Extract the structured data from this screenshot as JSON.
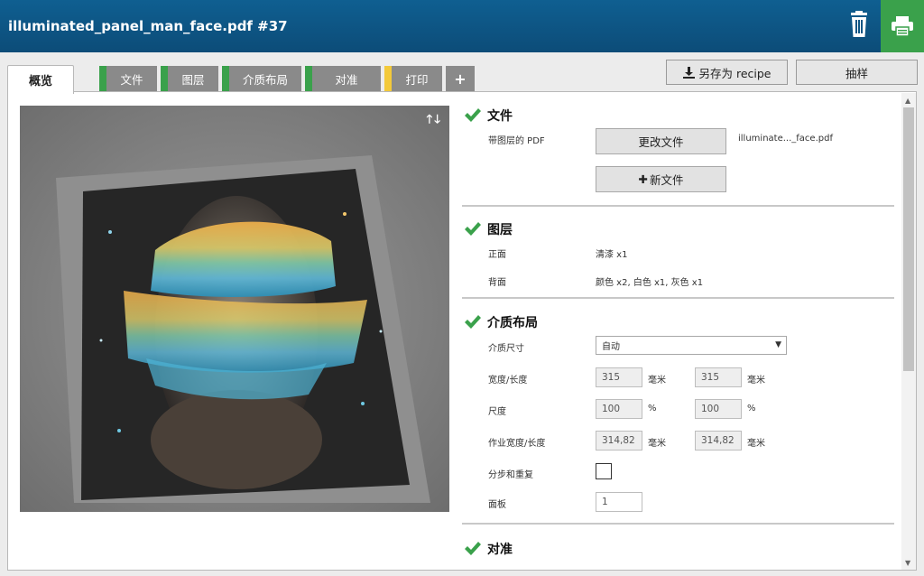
{
  "header": {
    "title": "illuminated_panel_man_face.pdf #37",
    "accent": "#0c4c78",
    "print_color": "#3aa14b"
  },
  "tabs": [
    {
      "label": "概览",
      "active": true
    },
    {
      "label": "文件",
      "status_color": "#3aa14b"
    },
    {
      "label": "图层",
      "status_color": "#3aa14b"
    },
    {
      "label": "介质布局",
      "status_color": "#3aa14b"
    },
    {
      "label": "对准",
      "status_color": "#3aa14b"
    },
    {
      "label": "打印",
      "status_color": "#f3c93a"
    },
    {
      "label": "+",
      "icon": "plus-icon"
    }
  ],
  "toolbar": {
    "save_recipe": "另存为 recipe",
    "sample": "抽样"
  },
  "preview": {
    "arrows": "🡑🡓"
  },
  "sections": {
    "file": {
      "title": "文件",
      "label": "带图层的 PDF",
      "change_button": "更改文件",
      "new_button": "新文件",
      "filename": "illuminate..._face.pdf"
    },
    "layers": {
      "title": "图层",
      "front_label": "正面",
      "front_value": "清漆 x1",
      "back_label": "背面",
      "back_value": "颜色 x2, 白色 x1, 灰色 x1"
    },
    "media": {
      "title": "介质布局",
      "size_label": "介质尺寸",
      "size_value": "自动",
      "wh_label": "宽度/长度",
      "width": "315",
      "length": "315",
      "mm": "毫米",
      "scale_label": "尺度",
      "scale_x": "100",
      "scale_y": "100",
      "pct": "%",
      "job_label": "作业宽度/长度",
      "job_width": "314,82",
      "job_length": "314,82",
      "step_label": "分步和重复",
      "panel_label": "面板",
      "panel_value": "1"
    },
    "align": {
      "title": "对准"
    }
  }
}
